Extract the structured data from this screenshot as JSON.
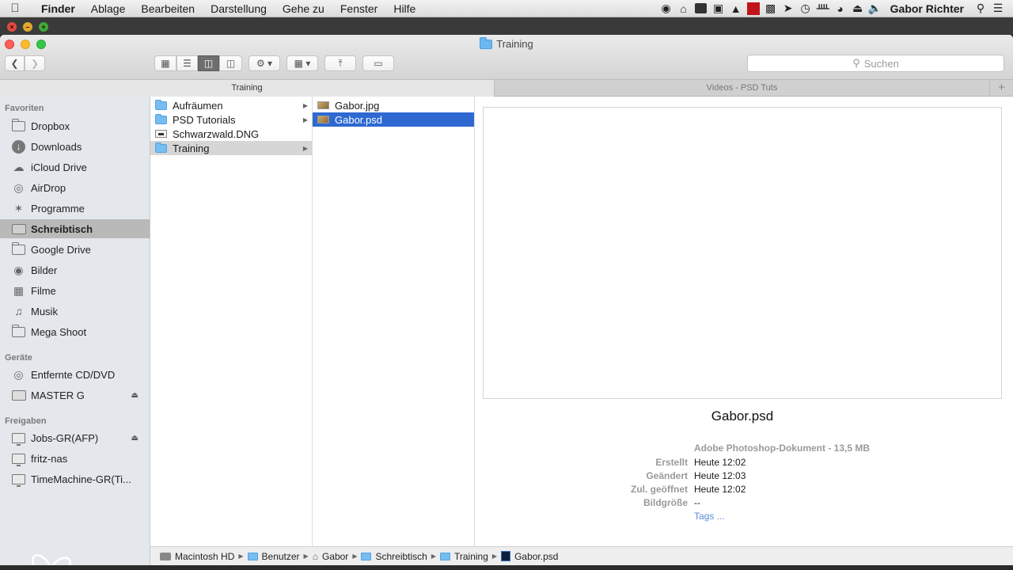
{
  "menubar": {
    "apple": "",
    "items": [
      "Finder",
      "Ablage",
      "Bearbeiten",
      "Darstellung",
      "Gehe zu",
      "Fenster",
      "Hilfe"
    ],
    "user": "Gabor Richter"
  },
  "window": {
    "title": "Training",
    "search_placeholder": "Suchen",
    "tabs": [
      "Training",
      "Videos - PSD Tuts"
    ],
    "tab_add": "+"
  },
  "sidebar": {
    "sections": [
      {
        "header": "Favoriten",
        "items": [
          {
            "label": "Dropbox",
            "icon": "folder-icon"
          },
          {
            "label": "Downloads",
            "icon": "download-icon"
          },
          {
            "label": "iCloud Drive",
            "icon": "cloud-icon"
          },
          {
            "label": "AirDrop",
            "icon": "airdrop-icon"
          },
          {
            "label": "Programme",
            "icon": "apps-icon"
          },
          {
            "label": "Schreibtisch",
            "icon": "desktop-icon",
            "selected": true
          },
          {
            "label": "Google Drive",
            "icon": "folder-icon"
          },
          {
            "label": "Bilder",
            "icon": "camera-icon"
          },
          {
            "label": "Filme",
            "icon": "film-icon"
          },
          {
            "label": "Musik",
            "icon": "music-icon"
          },
          {
            "label": "Mega Shoot",
            "icon": "folder-icon"
          }
        ]
      },
      {
        "header": "Geräte",
        "items": [
          {
            "label": "Entfernte CD/DVD",
            "icon": "disc-icon"
          },
          {
            "label": "MASTER G",
            "icon": "drive-icon",
            "eject": true
          }
        ]
      },
      {
        "header": "Freigaben",
        "items": [
          {
            "label": "Jobs-GR(AFP)",
            "icon": "server-icon",
            "eject": true
          },
          {
            "label": "fritz-nas",
            "icon": "server-icon"
          },
          {
            "label": "TimeMachine-GR(Ti...",
            "icon": "server-icon"
          }
        ]
      }
    ]
  },
  "columns": {
    "col1": [
      {
        "label": "Aufräumen",
        "type": "folder",
        "arrow": true
      },
      {
        "label": "PSD Tutorials",
        "type": "folder",
        "arrow": true
      },
      {
        "label": "Schwarzwald.DNG",
        "type": "dng",
        "arrow": false
      },
      {
        "label": "Training",
        "type": "folder",
        "arrow": true,
        "selected": true
      }
    ],
    "col2": [
      {
        "label": "Gabor.jpg",
        "type": "image"
      },
      {
        "label": "Gabor.psd",
        "type": "image",
        "selected": true
      }
    ]
  },
  "preview": {
    "filename": "Gabor.psd",
    "kind": "Adobe Photoshop-Dokument - 13,5 MB",
    "meta": [
      {
        "label": "Erstellt",
        "value": "Heute 12:02"
      },
      {
        "label": "Geändert",
        "value": "Heute 12:03"
      },
      {
        "label": "Zul. geöffnet",
        "value": "Heute 12:02"
      },
      {
        "label": "Bildgröße",
        "value": "--"
      }
    ],
    "tags": "Tags ..."
  },
  "pathbar": [
    {
      "label": "Macintosh HD",
      "icon": "hd"
    },
    {
      "label": "Benutzer",
      "icon": "folder"
    },
    {
      "label": "Gabor",
      "icon": "home"
    },
    {
      "label": "Schreibtisch",
      "icon": "folder"
    },
    {
      "label": "Training",
      "icon": "folder"
    },
    {
      "label": "Gabor.psd",
      "icon": "psd"
    }
  ],
  "colors": {
    "selection_blue": "#2e69d2",
    "sidebar_bg": "#e4e7eb",
    "folder_blue": "#76bdf2"
  }
}
